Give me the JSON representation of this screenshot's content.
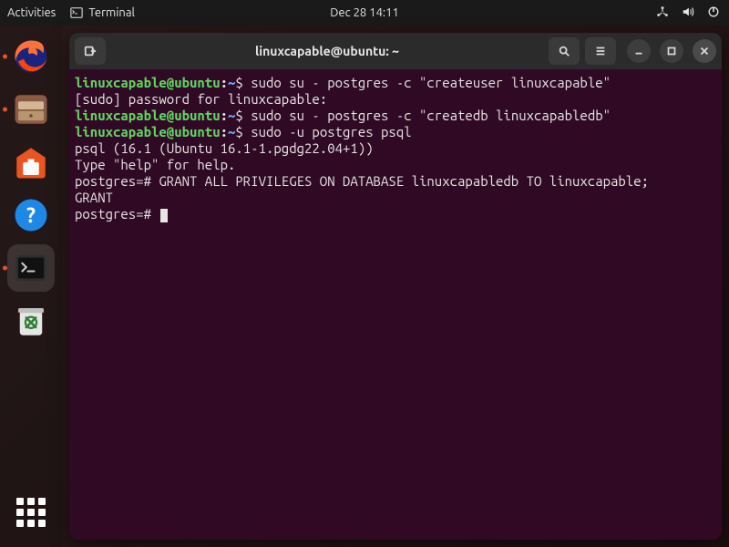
{
  "topbar": {
    "activities": "Activities",
    "app_indicator": "Terminal",
    "clock": "Dec 28  14:11"
  },
  "dock": {
    "items": [
      {
        "name": "firefox",
        "running": true
      },
      {
        "name": "files",
        "running": true
      },
      {
        "name": "software",
        "running": false
      },
      {
        "name": "help",
        "running": false
      },
      {
        "name": "terminal",
        "running": true,
        "active": true
      },
      {
        "name": "trash",
        "running": false
      }
    ]
  },
  "window": {
    "title": "linuxcapable@ubuntu: ~"
  },
  "terminal": {
    "prompt_user": "linuxcapable@ubuntu",
    "prompt_path": "~",
    "prompt_symbol": "$",
    "lines": {
      "l0_cmd": " sudo su - postgres -c \"createuser linuxcapable\"",
      "l1": "[sudo] password for linuxcapable: ",
      "l2_cmd": " sudo su - postgres -c \"createdb linuxcapabledb\"",
      "l3_cmd": " sudo -u postgres psql",
      "l4": "psql (16.1 (Ubuntu 16.1-1.pgdg22.04+1))",
      "l5": "Type \"help\" for help.",
      "l6": "",
      "l7": "postgres=# GRANT ALL PRIVILEGES ON DATABASE linuxcapabledb TO linuxcapable;",
      "l8": "GRANT",
      "l9": "postgres=# "
    }
  }
}
